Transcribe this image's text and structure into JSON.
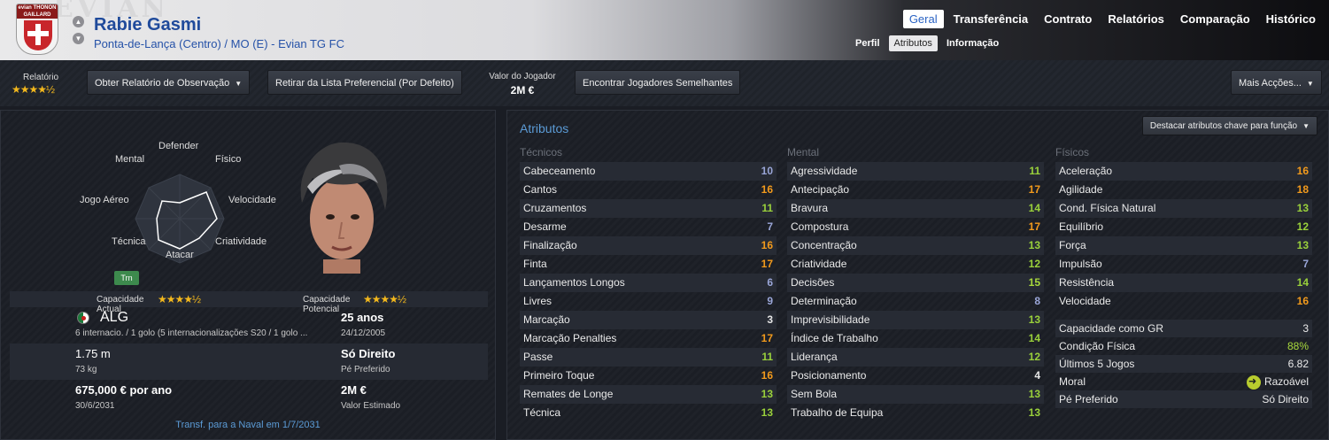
{
  "header": {
    "player_name": "Rabie Gasmi",
    "subtitle": "Ponta-de-Lança (Centro) / MO (E) - Evian TG FC",
    "crest_text": "evian THONON GAILLARD",
    "top_tabs": [
      "Geral",
      "Transferência",
      "Contrato",
      "Relatórios",
      "Comparação",
      "Histórico"
    ],
    "active_top_tab": "Geral",
    "sub_tabs": [
      "Perfil",
      "Atributos",
      "Informação"
    ],
    "active_sub_tab": "Atributos"
  },
  "toolbar": {
    "relatorio_label": "Relatório",
    "relatorio_stars": "★★★★½",
    "scout_report_btn": "Obter Relatório de Observação",
    "shortlist_btn": "Retirar da Lista Preferencial (Por Defeito)",
    "valor_label": "Valor do Jogador",
    "valor_value": "2M €",
    "similar_btn": "Encontrar Jogadores Semelhantes",
    "more_actions_btn": "Mais Acções..."
  },
  "profile": {
    "radar_labels": {
      "defender": "Defender",
      "fisico": "Físico",
      "velocidade": "Velocidade",
      "criatividade": "Criatividade",
      "atacar": "Atacar",
      "tecnica": "Técnica",
      "jogo_aereo": "Jogo Aéreo",
      "mental": "Mental"
    },
    "trn_badge": "Trn",
    "cap_actual_label": "Capacidade Actual",
    "cap_actual_stars": "★★★★½",
    "cap_potencial_label": "Capacidade Potencial",
    "cap_potencial_stars": "★★★★½",
    "nationality": "ALG",
    "caps": "6 internacio. / 1 golo (5 internacionalizações S20 / 1 golo ...",
    "age": "25 anos",
    "dob": "24/12/2005",
    "height": "1.75 m",
    "weight": "73 kg",
    "foot": "Só Direito",
    "foot_label": "Pé Preferido",
    "wage": "675,000 € por ano",
    "contract_end": "30/6/2031",
    "est_value": "2M €",
    "est_value_label": "Valor Estimado",
    "transfer_note": "Transf. para a Naval em 1/7/2031"
  },
  "attributes": {
    "title": "Atributos",
    "highlight_btn": "Destacar atributos chave para função",
    "tecnicos_head": "Técnicos",
    "mental_head": "Mental",
    "fisicos_head": "Físicos",
    "tecnicos": [
      {
        "name": "Cabeceamento",
        "value": "10"
      },
      {
        "name": "Cantos",
        "value": "16"
      },
      {
        "name": "Cruzamentos",
        "value": "11"
      },
      {
        "name": "Desarme",
        "value": "7"
      },
      {
        "name": "Finalização",
        "value": "16"
      },
      {
        "name": "Finta",
        "value": "17"
      },
      {
        "name": "Lançamentos Longos",
        "value": "6"
      },
      {
        "name": "Livres",
        "value": "9"
      },
      {
        "name": "Marcação",
        "value": "3"
      },
      {
        "name": "Marcação Penalties",
        "value": "17"
      },
      {
        "name": "Passe",
        "value": "11"
      },
      {
        "name": "Primeiro Toque",
        "value": "16"
      },
      {
        "name": "Remates de Longe",
        "value": "13"
      },
      {
        "name": "Técnica",
        "value": "13"
      }
    ],
    "mental": [
      {
        "name": "Agressividade",
        "value": "11"
      },
      {
        "name": "Antecipação",
        "value": "17"
      },
      {
        "name": "Bravura",
        "value": "14"
      },
      {
        "name": "Compostura",
        "value": "17"
      },
      {
        "name": "Concentração",
        "value": "13"
      },
      {
        "name": "Criatividade",
        "value": "12"
      },
      {
        "name": "Decisões",
        "value": "15"
      },
      {
        "name": "Determinação",
        "value": "8"
      },
      {
        "name": "Imprevisibilidade",
        "value": "13"
      },
      {
        "name": "Índice de Trabalho",
        "value": "14"
      },
      {
        "name": "Liderança",
        "value": "12"
      },
      {
        "name": "Posicionamento",
        "value": "4"
      },
      {
        "name": "Sem Bola",
        "value": "13"
      },
      {
        "name": "Trabalho de Equipa",
        "value": "13"
      }
    ],
    "fisicos": [
      {
        "name": "Aceleração",
        "value": "16"
      },
      {
        "name": "Agilidade",
        "value": "18"
      },
      {
        "name": "Cond. Física Natural",
        "value": "13"
      },
      {
        "name": "Equilíbrio",
        "value": "12"
      },
      {
        "name": "Força",
        "value": "13"
      },
      {
        "name": "Impulsão",
        "value": "7"
      },
      {
        "name": "Resistência",
        "value": "14"
      },
      {
        "name": "Velocidade",
        "value": "16"
      }
    ],
    "stats": [
      {
        "name": "Capacidade como GR",
        "value": "3"
      },
      {
        "name": "Condição Física",
        "value": "88%"
      },
      {
        "name": "Últimos 5 Jogos",
        "value": "6.82"
      },
      {
        "name": "Moral",
        "value": "Razoável"
      },
      {
        "name": "Pé Preferido",
        "value": "Só Direito"
      }
    ]
  }
}
